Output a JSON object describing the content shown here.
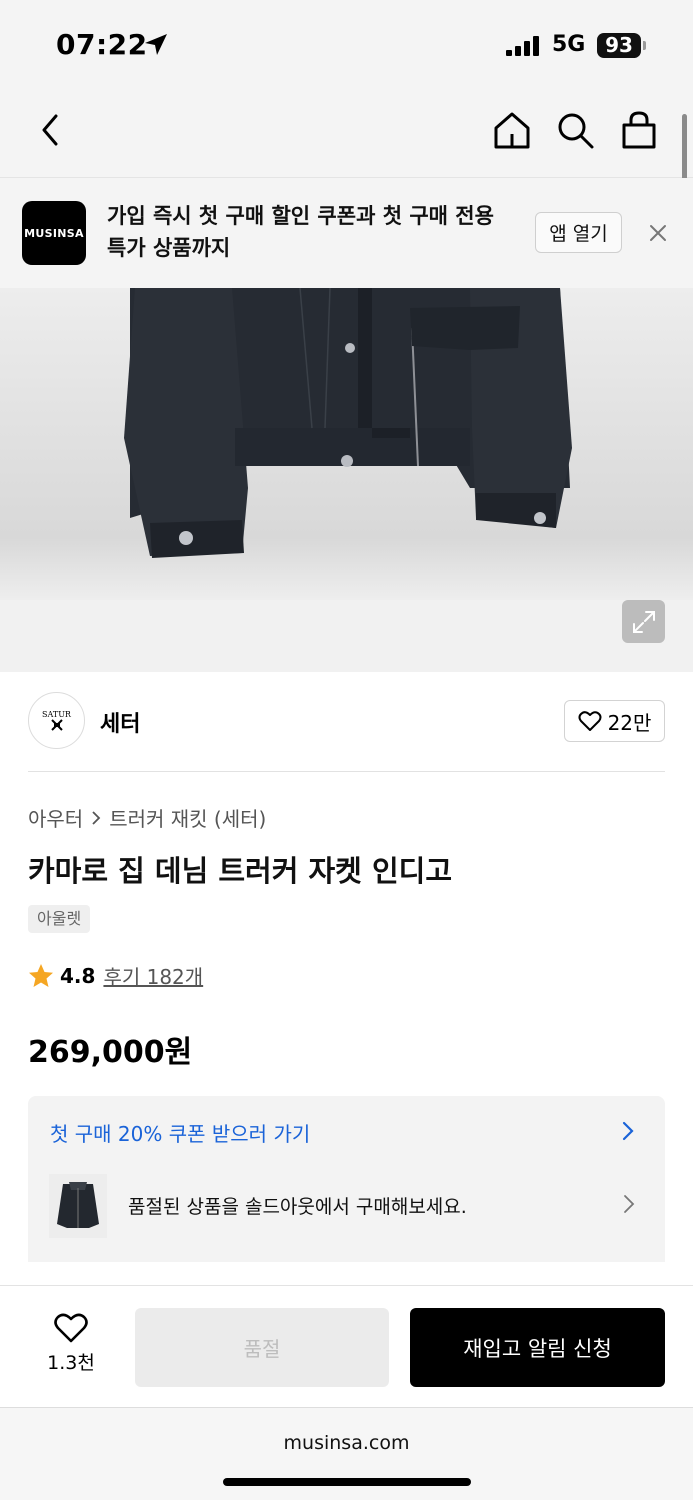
{
  "status_bar": {
    "time": "07:22",
    "network": "5G",
    "battery": "93"
  },
  "nav": {
    "back_icon": "chevron-left-icon",
    "home_icon": "home-icon",
    "search_icon": "search-icon",
    "cart_icon": "shopping-bag-icon"
  },
  "app_banner": {
    "logo_text": "MUSINSA",
    "text": "가입 즉시 첫 구매 할인 쿠폰과 첫 구매 전용 특가 상품까지",
    "open_label": "앱 열기",
    "close_icon": "close-icon"
  },
  "brand": {
    "logo_text": "SATUR",
    "name": "세터",
    "likes": "22만"
  },
  "product": {
    "breadcrumb": [
      "아우터",
      "트러커 재킷 (세터)"
    ],
    "title": "카마로 집 데님 트러커 자켓 인디고",
    "tag": "아울렛",
    "rating": "4.8",
    "review_label": "후기 182개",
    "price": "269,000원"
  },
  "promo": {
    "coupon_text": "첫 구매 20% 쿠폰 받으러 가기",
    "soldout_text": "품절된 상품을 솔드아웃에서 구매해보세요."
  },
  "actions": {
    "wish_count": "1.3천",
    "soldout_label": "품절",
    "restock_label": "재입고 알림 신청"
  },
  "browser": {
    "url": "musinsa.com"
  },
  "colors": {
    "accent_blue": "#1a63d8",
    "primary_button": "#000000",
    "disabled_button": "#ebebeb",
    "star": "#f5a623"
  }
}
